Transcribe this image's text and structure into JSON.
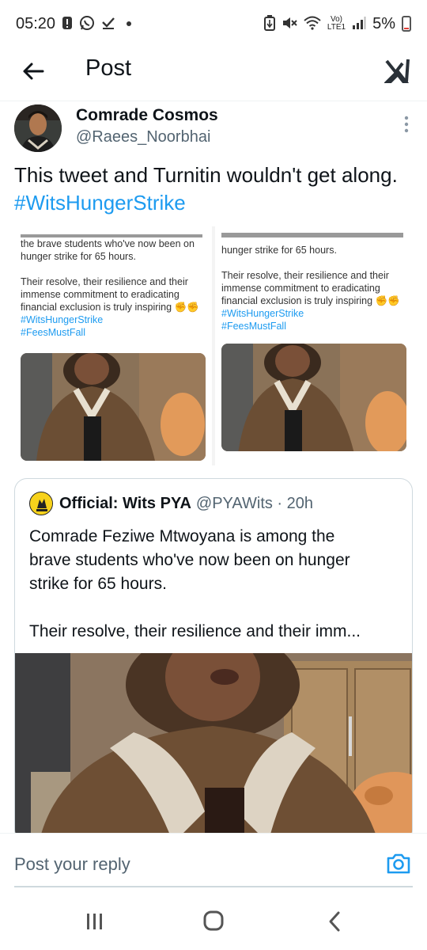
{
  "status_bar": {
    "time": "05:20",
    "lte_label_top": "Vo)",
    "lte_label_bottom": "LTE1",
    "battery_percent": "5%"
  },
  "header": {
    "title": "Post"
  },
  "post": {
    "author_name": "Comrade Cosmos",
    "author_handle": "@Raees_Noorbhai",
    "text": "This tweet and Turnitin wouldn't get along.",
    "hashtag": "#WitsHungerStrike"
  },
  "screenshots": {
    "left": {
      "line1": "the brave students who've now been on",
      "line2": "hunger strike for 65 hours.",
      "line3": "Their resolve, their resilience and their",
      "line4": "immense commitment to eradicating",
      "line5": "financial exclusion is truly inspiring",
      "tag1": "#WitsHungerStrike",
      "tag2": "#FeesMustFall"
    },
    "right": {
      "line1": "hunger strike for 65 hours.",
      "line2": "Their resolve, their resilience and their",
      "line3": "immense commitment to eradicating",
      "line4": "financial exclusion is truly inspiring",
      "tag1": "#WitsHungerStrike",
      "tag2": "#FeesMustFall"
    }
  },
  "quote": {
    "name": "Official: Wits PYA",
    "handle": "@PYAWits · 20h",
    "text_line1": "Comrade Feziwe Mtwoyana is among the",
    "text_line2": "brave students who've now been on hunger",
    "text_line3": "strike for 65 hours.",
    "text_line4": "Their resolve, their resilience and their imm..."
  },
  "reply": {
    "placeholder": "Post your reply"
  },
  "colors": {
    "accent": "#1d9bf0",
    "text": "#0f1419",
    "secondary": "#536471"
  }
}
